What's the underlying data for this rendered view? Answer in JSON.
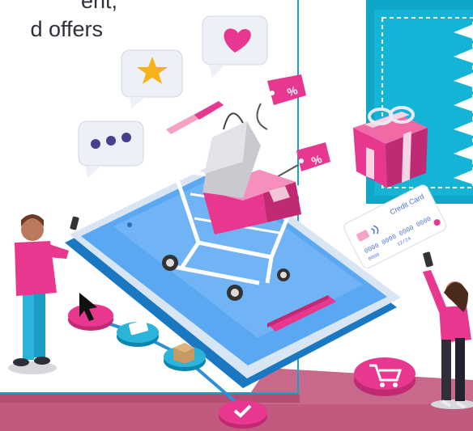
{
  "headline": {
    "line1": "ent,",
    "line2": "d offers"
  },
  "card": {
    "label": "Credit Card",
    "number": "0000 0000 0000 0000",
    "small": "0000",
    "expiry": "12/24"
  },
  "tags": {
    "discount": "%"
  },
  "colors": {
    "accent_pink": "#e8378e",
    "teal_panel": "#0fa6c9",
    "phone_screen": "#5aa7f2",
    "bottom_band": "#c05a7e"
  },
  "icons": [
    "star-icon",
    "heart-icon",
    "dots-icon",
    "cart-icon",
    "check-icon",
    "wifi-icon",
    "cursor-icon",
    "package-icon"
  ]
}
